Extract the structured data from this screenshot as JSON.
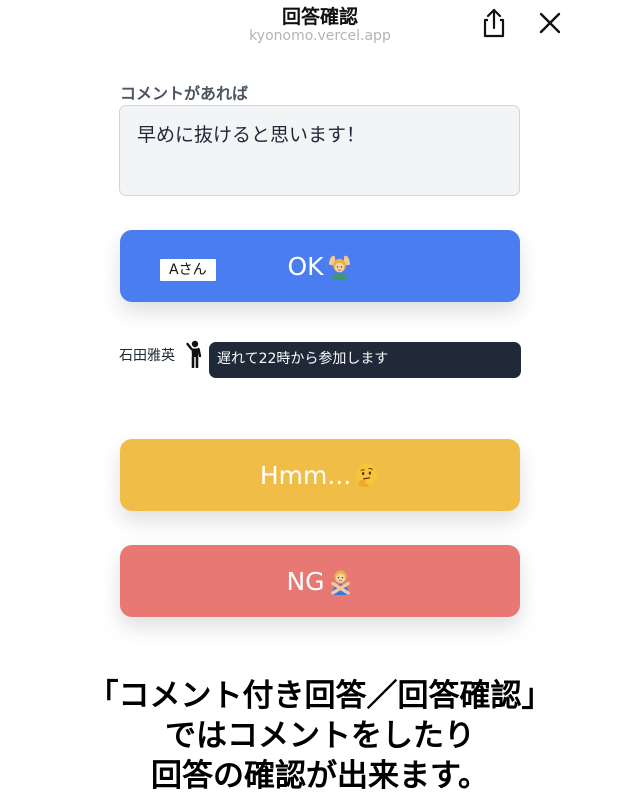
{
  "header": {
    "title": "回答確認",
    "url": "kyonomo.vercel.app",
    "share_icon": "share-icon",
    "close_icon": "close-icon"
  },
  "comment": {
    "label": "コメントがあれば",
    "value": "早めに抜けると思います！"
  },
  "answers": {
    "ok": {
      "label": "OK",
      "emoji": "person-gesturing-ok",
      "color": "#4a7def",
      "responders": [
        "Aさん"
      ]
    },
    "hmm": {
      "label": "Hmm...",
      "emoji": "thinking-face",
      "color": "#f0be46"
    },
    "ng": {
      "label": "NG",
      "emoji": "person-gesturing-no",
      "color": "#e77874"
    }
  },
  "commenter": {
    "name": "石田雅英",
    "icon": "person-standing-icon",
    "comment": "遅れて22時から参加します"
  },
  "caption": {
    "line1": "「コメント付き回答／回答確認」",
    "line2": "ではコメントをしたり",
    "line3": "回答の確認が出来ます。"
  }
}
